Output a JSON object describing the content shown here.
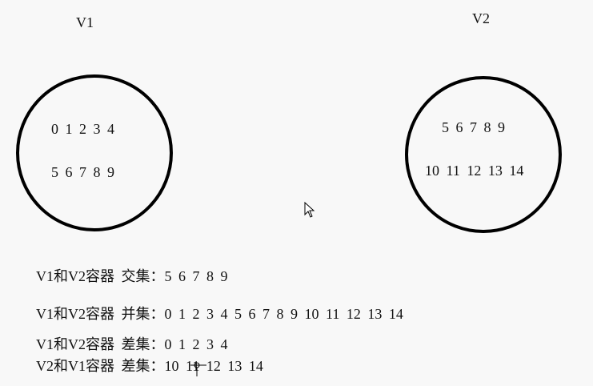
{
  "sets": [
    {
      "title": "V1",
      "rows": [
        "0 1 2 3 4",
        "5 6 7 8 9"
      ]
    },
    {
      "title": "V2",
      "rows": [
        "5 6 7 8 9",
        "10 11 12 13 14"
      ]
    }
  ],
  "results": [
    {
      "label": "V1和V2容器 交集：",
      "values": "5 6 7 8 9"
    },
    {
      "label": "V1和V2容器 并集：",
      "values": "0 1 2 3 4 5 6 7 8 9 10 11 12 13 14"
    },
    {
      "label": "V1和V2容器 差集：",
      "values": "0 1 2 3 4"
    },
    {
      "label": "V2和V1容器 差集：",
      "values": "10 11 12 13 14"
    }
  ]
}
